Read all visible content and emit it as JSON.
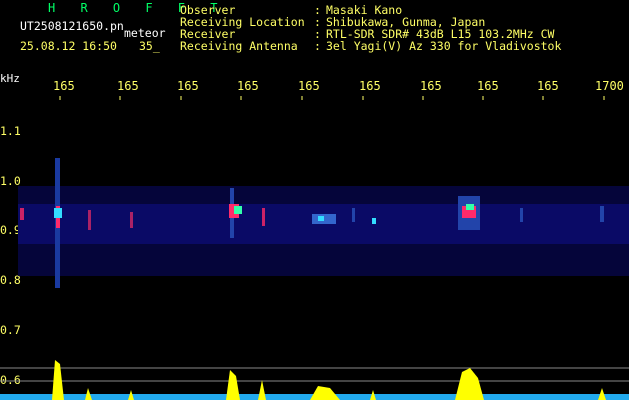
{
  "header": {
    "title": "H R O F F T",
    "filename": "UT2508121650.pn",
    "tag": "meteor",
    "datetime": "25.08.12 16:50",
    "count": "35_"
  },
  "meta": [
    {
      "key": "Observer",
      "value": "Masaki Kano"
    },
    {
      "key": "Receiving Location",
      "value": "Shibukawa, Gunma, Japan"
    },
    {
      "key": "Receiver",
      "value": "RTL-SDR SDR# 43dB L15 103.2MHz CW"
    },
    {
      "key": "Receiving Antenna",
      "value": "3el Yagi(V) Az 330 for Vladivostok"
    }
  ],
  "axis": {
    "y_unit": "kHz",
    "x_ticks": [
      "165",
      "165",
      "165",
      "165",
      "165",
      "165",
      "165",
      "165",
      "165",
      "1700"
    ],
    "y_ticks": [
      "1.1",
      "1.0",
      "0.9",
      "0.8",
      "0.7",
      "0.6"
    ]
  },
  "colors": {
    "bg": "#000000",
    "text_yellow": "#ffff66",
    "title_green": "#00ff66",
    "band": "#0a0a66"
  }
}
